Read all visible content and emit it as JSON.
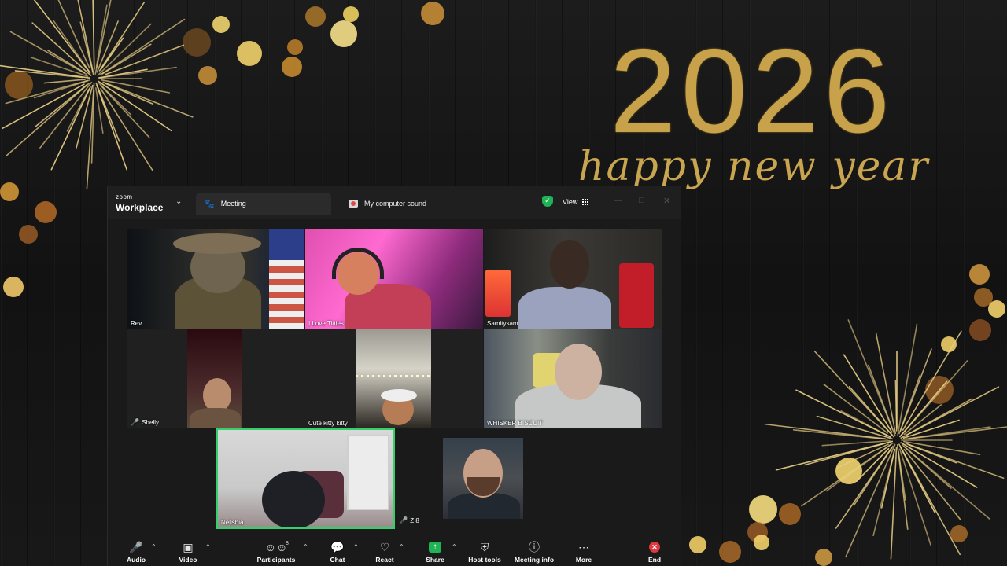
{
  "background": {
    "year": "2026",
    "greeting": "happy new year"
  },
  "window": {
    "brand_small": "zoom",
    "brand_large": "Workplace",
    "tabs": [
      {
        "label": "Meeting"
      },
      {
        "label": "My computer sound"
      }
    ],
    "view_label": "View"
  },
  "participants": [
    {
      "name": "Rev",
      "muted": false
    },
    {
      "name": "I Love Titties",
      "muted": false
    },
    {
      "name": "Samitysam",
      "muted": false
    },
    {
      "name": "Shelly",
      "muted": true
    },
    {
      "name": "Cute kitty kitty",
      "muted": false
    },
    {
      "name": "WHISKER BISCUIT",
      "muted": false
    },
    {
      "name": "Nelishia",
      "muted": false,
      "active_speaker": true
    },
    {
      "name": "Z 8",
      "muted": true
    }
  ],
  "toolbar": {
    "audio": "Audio",
    "video": "Video",
    "participants": "Participants",
    "participant_count": "8",
    "chat": "Chat",
    "react": "React",
    "share": "Share",
    "host_tools": "Host tools",
    "meeting_info": "Meeting info",
    "more": "More",
    "end": "End"
  },
  "colors": {
    "accent_green": "#1fb356",
    "end_red": "#e0383e",
    "gold": "#c7a24a",
    "active_speaker_border": "#35d06b"
  }
}
